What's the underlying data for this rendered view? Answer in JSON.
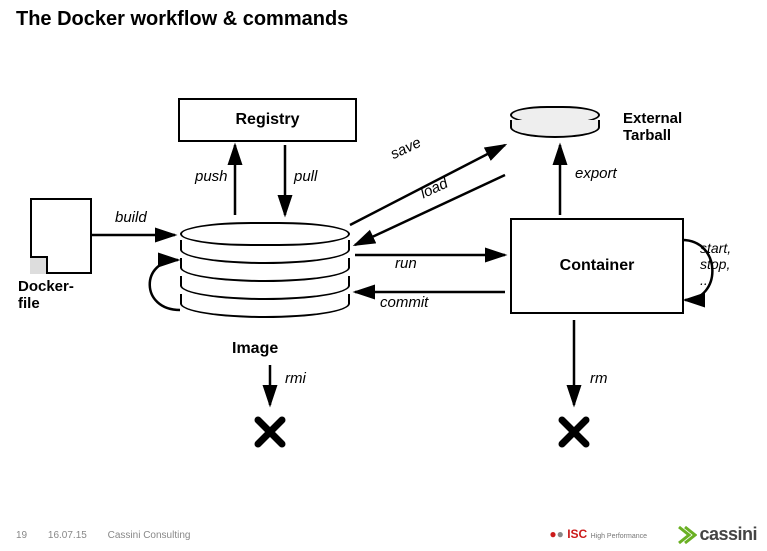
{
  "title": "The Docker workflow & commands",
  "nodes": {
    "registry": "Registry",
    "image": "Image",
    "container": "Container",
    "dockerfile": "Docker-\nfile",
    "tarball": "External\nTarball"
  },
  "edges": {
    "build": "build",
    "push": "push",
    "pull": "pull",
    "save": "save",
    "load": "load",
    "run": "run",
    "commit": "commit",
    "export": "export",
    "rmi": "rmi",
    "rm": "rm",
    "lifecycle": "start,\nstop,\n..."
  },
  "footer": {
    "page": "19",
    "date": "16.07.15",
    "org": "Cassini Consulting"
  },
  "logos": {
    "isc": "ISC",
    "isc_sub": "High Performance",
    "cassini": "cassini"
  }
}
